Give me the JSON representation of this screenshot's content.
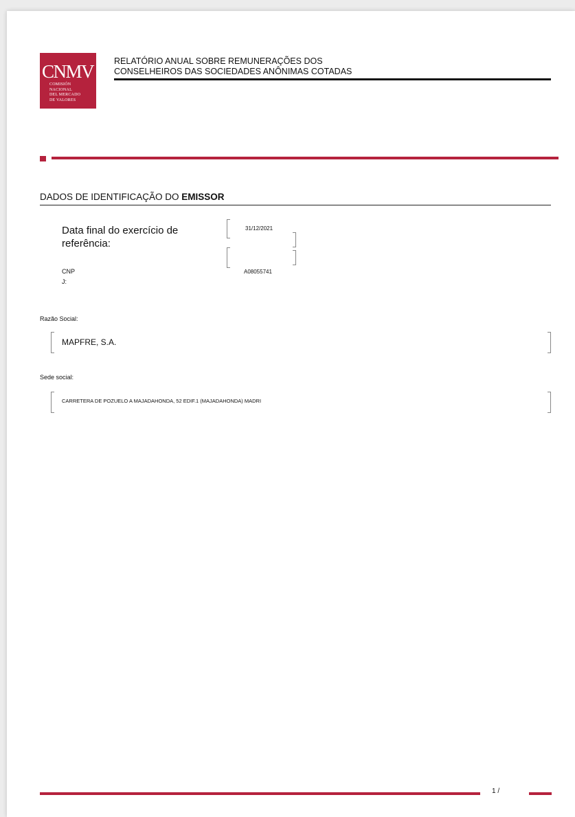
{
  "logo": {
    "acronym": "CNMV",
    "line1": "COMISIÓN",
    "line2": "NACIONAL",
    "line3": "DEL MERCADO",
    "line4": "DE VALORES",
    "color": "#b5223d"
  },
  "report": {
    "title_line1": "RELATÓRIO ANUAL SOBRE REMUNERAÇÕES DOS",
    "title_line2": "CONSELHEIROS DAS SOCIEDADES ANÔNIMAS COTADAS"
  },
  "section": {
    "title_prefix": "DADOS DE IDENTIFICAÇÃO DO ",
    "title_bold": "EMISSOR"
  },
  "fields": {
    "fiscal_year_end_label": "Data final do exercício de referência:",
    "fiscal_year_end_value": "31/12/2021",
    "cnpj_label_line1": "CNP",
    "cnpj_label_line2": "J:",
    "cnpj_value": "A08055741",
    "company_name_label": "Razão Social:",
    "company_name_value": "MAPFRE, S.A.",
    "registered_office_label": "Sede social:",
    "registered_office_value": "CARRETERA DE POZUELO A MAJADAHONDA, 52 EDIF.1 (MAJADAHONDA) MADRI"
  },
  "footer": {
    "page_number": "1 /"
  }
}
